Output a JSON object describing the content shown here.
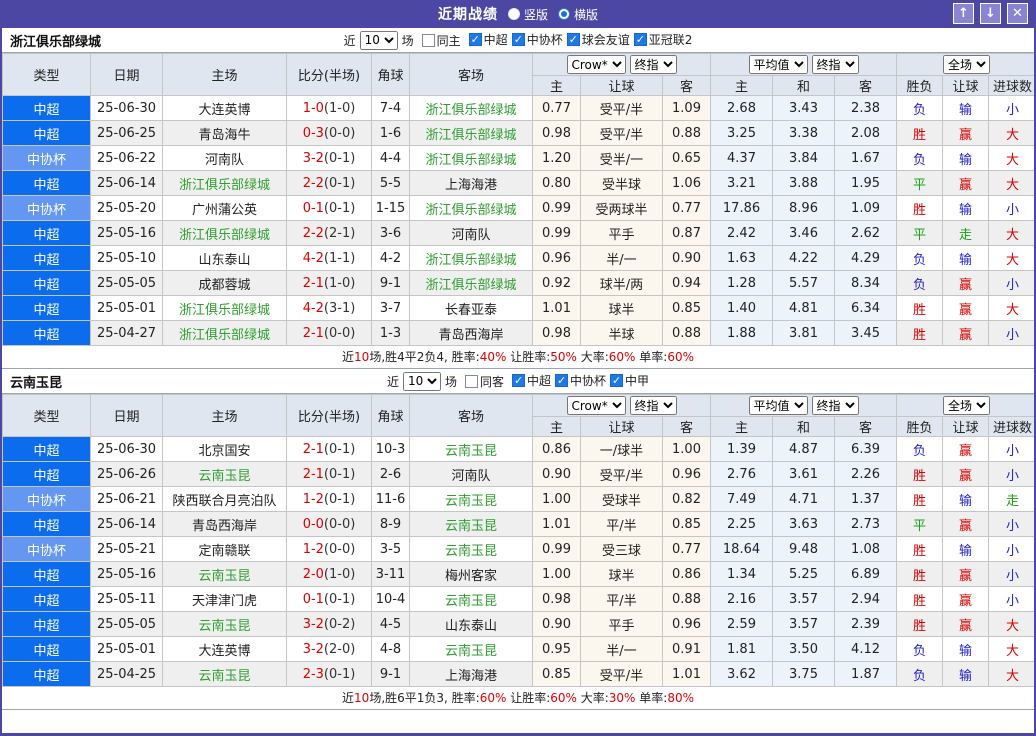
{
  "window": {
    "title": "近期战绩",
    "view_options": [
      {
        "label": "竖版",
        "checked": false
      },
      {
        "label": "横版",
        "checked": true
      }
    ],
    "controls": {
      "up_icon": "↑",
      "down_icon": "↓",
      "close_icon": "✕"
    }
  },
  "colors": {
    "accent_purple": "#4b47a3",
    "league_super_blue": "#0c6cee",
    "league_cup_blue": "#6397f2",
    "focus_team_green": "#2f9e2f",
    "win_red": "#dd0000",
    "lose_blue": "#2222cc",
    "draw_green": "#1ba11b",
    "handicap_bg": "#fcf7ee",
    "average_bg": "#ecf3fa",
    "header_bg": "#dfe6ef"
  },
  "table_header": {
    "left_columns": [
      "类型",
      "日期",
      "主场",
      "比分(半场)",
      "角球",
      "客场"
    ],
    "dropdown_groups": [
      [
        "Crow*",
        "终指"
      ],
      [
        "平均值",
        "终指"
      ],
      [
        "全场"
      ]
    ],
    "sub_columns": [
      "主",
      "让球",
      "客",
      "主",
      "和",
      "客",
      "胜负",
      "让球",
      "进球数"
    ]
  },
  "sections": [
    {
      "team": "浙江俱乐部绿城",
      "filter": {
        "prefix": "近",
        "count": "10",
        "suffix": "场",
        "same_label": "同主",
        "same_checked": false,
        "leagues": [
          {
            "label": "中超",
            "checked": true
          },
          {
            "label": "中协杯",
            "checked": true
          },
          {
            "label": "球会友谊",
            "checked": true
          },
          {
            "label": "亚冠联2",
            "checked": true
          }
        ]
      },
      "rows": [
        {
          "league": "中超",
          "league_cls": "sup",
          "date": "25-06-30",
          "home": "大连英博",
          "home_focus": false,
          "score": "1-0",
          "half": "(1-0)",
          "corners": "7-4",
          "away": "浙江俱乐部绿城",
          "away_focus": true,
          "handicap": [
            "0.77",
            "受平/半",
            "1.09"
          ],
          "average": [
            "2.68",
            "3.43",
            "2.38"
          ],
          "results": [
            [
              "负",
              "blue"
            ],
            [
              "输",
              "blue"
            ],
            [
              "小",
              "blue"
            ]
          ]
        },
        {
          "league": "中超",
          "league_cls": "sup",
          "date": "25-06-25",
          "home": "青岛海牛",
          "home_focus": false,
          "score": "0-3",
          "half": "(0-0)",
          "corners": "1-6",
          "away": "浙江俱乐部绿城",
          "away_focus": true,
          "handicap": [
            "0.98",
            "受平/半",
            "0.88"
          ],
          "average": [
            "3.25",
            "3.38",
            "2.08"
          ],
          "results": [
            [
              "胜",
              "red"
            ],
            [
              "赢",
              "red"
            ],
            [
              "大",
              "red"
            ]
          ]
        },
        {
          "league": "中协杯",
          "league_cls": "cup",
          "date": "25-06-22",
          "home": "河南队",
          "home_focus": false,
          "score": "3-2",
          "half": "(0-1)",
          "corners": "4-4",
          "away": "浙江俱乐部绿城",
          "away_focus": true,
          "handicap": [
            "1.20",
            "受半/一",
            "0.65"
          ],
          "average": [
            "4.37",
            "3.84",
            "1.67"
          ],
          "results": [
            [
              "负",
              "blue"
            ],
            [
              "输",
              "blue"
            ],
            [
              "大",
              "red"
            ]
          ]
        },
        {
          "league": "中超",
          "league_cls": "sup",
          "date": "25-06-14",
          "home": "浙江俱乐部绿城",
          "home_focus": true,
          "score": "2-2",
          "half": "(0-1)",
          "corners": "5-5",
          "away": "上海海港",
          "away_focus": false,
          "handicap": [
            "0.80",
            "受半球",
            "1.06"
          ],
          "average": [
            "3.21",
            "3.88",
            "1.95"
          ],
          "results": [
            [
              "平",
              "green"
            ],
            [
              "赢",
              "red"
            ],
            [
              "大",
              "red"
            ]
          ]
        },
        {
          "league": "中协杯",
          "league_cls": "cup",
          "date": "25-05-20",
          "home": "广州蒲公英",
          "home_focus": false,
          "score": "0-1",
          "half": "(0-1)",
          "corners": "1-15",
          "away": "浙江俱乐部绿城",
          "away_focus": true,
          "handicap": [
            "0.99",
            "受两球半",
            "0.77"
          ],
          "average": [
            "17.86",
            "8.96",
            "1.09"
          ],
          "results": [
            [
              "胜",
              "red"
            ],
            [
              "输",
              "blue"
            ],
            [
              "小",
              "blue"
            ]
          ]
        },
        {
          "league": "中超",
          "league_cls": "sup",
          "date": "25-05-16",
          "home": "浙江俱乐部绿城",
          "home_focus": true,
          "score": "2-2",
          "half": "(2-1)",
          "corners": "3-6",
          "away": "河南队",
          "away_focus": false,
          "handicap": [
            "0.99",
            "平手",
            "0.87"
          ],
          "average": [
            "2.42",
            "3.46",
            "2.62"
          ],
          "results": [
            [
              "平",
              "green"
            ],
            [
              "走",
              "green"
            ],
            [
              "大",
              "red"
            ]
          ]
        },
        {
          "league": "中超",
          "league_cls": "sup",
          "date": "25-05-10",
          "home": "山东泰山",
          "home_focus": false,
          "score": "4-2",
          "half": "(1-1)",
          "corners": "4-2",
          "away": "浙江俱乐部绿城",
          "away_focus": true,
          "handicap": [
            "0.96",
            "半/一",
            "0.90"
          ],
          "average": [
            "1.63",
            "4.22",
            "4.29"
          ],
          "results": [
            [
              "负",
              "blue"
            ],
            [
              "输",
              "blue"
            ],
            [
              "大",
              "red"
            ]
          ]
        },
        {
          "league": "中超",
          "league_cls": "sup",
          "date": "25-05-05",
          "home": "成都蓉城",
          "home_focus": false,
          "score": "2-1",
          "half": "(1-0)",
          "corners": "9-1",
          "away": "浙江俱乐部绿城",
          "away_focus": true,
          "handicap": [
            "0.92",
            "球半/两",
            "0.94"
          ],
          "average": [
            "1.28",
            "5.57",
            "8.34"
          ],
          "results": [
            [
              "负",
              "blue"
            ],
            [
              "赢",
              "red"
            ],
            [
              "小",
              "blue"
            ]
          ]
        },
        {
          "league": "中超",
          "league_cls": "sup",
          "date": "25-05-01",
          "home": "浙江俱乐部绿城",
          "home_focus": true,
          "score": "4-2",
          "half": "(3-1)",
          "corners": "3-7",
          "away": "长春亚泰",
          "away_focus": false,
          "handicap": [
            "1.01",
            "球半",
            "0.85"
          ],
          "average": [
            "1.40",
            "4.81",
            "6.34"
          ],
          "results": [
            [
              "胜",
              "red"
            ],
            [
              "赢",
              "red"
            ],
            [
              "大",
              "red"
            ]
          ]
        },
        {
          "league": "中超",
          "league_cls": "sup",
          "date": "25-04-27",
          "home": "浙江俱乐部绿城",
          "home_focus": true,
          "score": "2-1",
          "half": "(0-0)",
          "corners": "1-3",
          "away": "青岛西海岸",
          "away_focus": false,
          "handicap": [
            "0.98",
            "半球",
            "0.88"
          ],
          "average": [
            "1.88",
            "3.81",
            "3.45"
          ],
          "results": [
            [
              "胜",
              "red"
            ],
            [
              "赢",
              "red"
            ],
            [
              "小",
              "blue"
            ]
          ]
        }
      ],
      "summary": [
        {
          "text": "近",
          "red": false
        },
        {
          "text": "10",
          "red": true
        },
        {
          "text": "场,胜4平2负4, 胜率:",
          "red": false
        },
        {
          "text": "40%",
          "red": true
        },
        {
          "text": " 让胜率:",
          "red": false
        },
        {
          "text": "50%",
          "red": true
        },
        {
          "text": " 大率:",
          "red": false
        },
        {
          "text": "60%",
          "red": true
        },
        {
          "text": " 单率:",
          "red": false
        },
        {
          "text": "60%",
          "red": true
        }
      ]
    },
    {
      "team": "云南玉昆",
      "filter": {
        "prefix": "近",
        "count": "10",
        "suffix": "场",
        "same_label": "同客",
        "same_checked": false,
        "leagues": [
          {
            "label": "中超",
            "checked": true
          },
          {
            "label": "中协杯",
            "checked": true
          },
          {
            "label": "中甲",
            "checked": true
          }
        ]
      },
      "rows": [
        {
          "league": "中超",
          "league_cls": "sup",
          "date": "25-06-30",
          "home": "北京国安",
          "home_focus": false,
          "score": "2-1",
          "half": "(0-1)",
          "corners": "10-3",
          "away": "云南玉昆",
          "away_focus": true,
          "handicap": [
            "0.86",
            "一/球半",
            "1.00"
          ],
          "average": [
            "1.39",
            "4.87",
            "6.39"
          ],
          "results": [
            [
              "负",
              "blue"
            ],
            [
              "赢",
              "red"
            ],
            [
              "小",
              "blue"
            ]
          ]
        },
        {
          "league": "中超",
          "league_cls": "sup",
          "date": "25-06-26",
          "home": "云南玉昆",
          "home_focus": true,
          "score": "2-1",
          "half": "(0-1)",
          "corners": "2-6",
          "away": "河南队",
          "away_focus": false,
          "handicap": [
            "0.90",
            "受平/半",
            "0.96"
          ],
          "average": [
            "2.76",
            "3.61",
            "2.26"
          ],
          "results": [
            [
              "胜",
              "red"
            ],
            [
              "赢",
              "red"
            ],
            [
              "小",
              "blue"
            ]
          ]
        },
        {
          "league": "中协杯",
          "league_cls": "cup",
          "date": "25-06-21",
          "home": "陕西联合月亮泊队",
          "home_focus": false,
          "score": "1-2",
          "half": "(0-1)",
          "corners": "11-6",
          "away": "云南玉昆",
          "away_focus": true,
          "handicap": [
            "1.00",
            "受球半",
            "0.82"
          ],
          "average": [
            "7.49",
            "4.71",
            "1.37"
          ],
          "results": [
            [
              "胜",
              "red"
            ],
            [
              "输",
              "blue"
            ],
            [
              "走",
              "green"
            ]
          ]
        },
        {
          "league": "中超",
          "league_cls": "sup",
          "date": "25-06-14",
          "home": "青岛西海岸",
          "home_focus": false,
          "score": "0-0",
          "half": "(0-0)",
          "corners": "8-9",
          "away": "云南玉昆",
          "away_focus": true,
          "handicap": [
            "1.01",
            "平/半",
            "0.85"
          ],
          "average": [
            "2.25",
            "3.63",
            "2.73"
          ],
          "results": [
            [
              "平",
              "green"
            ],
            [
              "赢",
              "red"
            ],
            [
              "小",
              "blue"
            ]
          ]
        },
        {
          "league": "中协杯",
          "league_cls": "cup",
          "date": "25-05-21",
          "home": "定南赣联",
          "home_focus": false,
          "score": "1-2",
          "half": "(0-0)",
          "corners": "3-5",
          "away": "云南玉昆",
          "away_focus": true,
          "handicap": [
            "0.99",
            "受三球",
            "0.77"
          ],
          "average": [
            "18.64",
            "9.48",
            "1.08"
          ],
          "results": [
            [
              "胜",
              "red"
            ],
            [
              "输",
              "blue"
            ],
            [
              "小",
              "blue"
            ]
          ]
        },
        {
          "league": "中超",
          "league_cls": "sup",
          "date": "25-05-16",
          "home": "云南玉昆",
          "home_focus": true,
          "score": "2-0",
          "half": "(1-0)",
          "corners": "3-11",
          "away": "梅州客家",
          "away_focus": false,
          "handicap": [
            "1.00",
            "球半",
            "0.86"
          ],
          "average": [
            "1.34",
            "5.25",
            "6.89"
          ],
          "results": [
            [
              "胜",
              "red"
            ],
            [
              "赢",
              "red"
            ],
            [
              "小",
              "blue"
            ]
          ]
        },
        {
          "league": "中超",
          "league_cls": "sup",
          "date": "25-05-11",
          "home": "天津津门虎",
          "home_focus": false,
          "score": "0-1",
          "half": "(0-1)",
          "corners": "10-4",
          "away": "云南玉昆",
          "away_focus": true,
          "handicap": [
            "0.98",
            "平/半",
            "0.88"
          ],
          "average": [
            "2.16",
            "3.57",
            "2.94"
          ],
          "results": [
            [
              "胜",
              "red"
            ],
            [
              "赢",
              "red"
            ],
            [
              "小",
              "blue"
            ]
          ]
        },
        {
          "league": "中超",
          "league_cls": "sup",
          "date": "25-05-05",
          "home": "云南玉昆",
          "home_focus": true,
          "score": "3-2",
          "half": "(0-2)",
          "corners": "4-5",
          "away": "山东泰山",
          "away_focus": false,
          "handicap": [
            "0.90",
            "平手",
            "0.96"
          ],
          "average": [
            "2.59",
            "3.57",
            "2.39"
          ],
          "results": [
            [
              "胜",
              "red"
            ],
            [
              "赢",
              "red"
            ],
            [
              "大",
              "red"
            ]
          ]
        },
        {
          "league": "中超",
          "league_cls": "sup",
          "date": "25-05-01",
          "home": "大连英博",
          "home_focus": false,
          "score": "3-2",
          "half": "(2-0)",
          "corners": "4-8",
          "away": "云南玉昆",
          "away_focus": true,
          "handicap": [
            "0.95",
            "半/一",
            "0.91"
          ],
          "average": [
            "1.81",
            "3.50",
            "4.12"
          ],
          "results": [
            [
              "负",
              "blue"
            ],
            [
              "输",
              "blue"
            ],
            [
              "大",
              "red"
            ]
          ]
        },
        {
          "league": "中超",
          "league_cls": "sup",
          "date": "25-04-25",
          "home": "云南玉昆",
          "home_focus": true,
          "score": "2-3",
          "half": "(0-1)",
          "corners": "9-1",
          "away": "上海海港",
          "away_focus": false,
          "handicap": [
            "0.85",
            "受平/半",
            "1.01"
          ],
          "average": [
            "3.62",
            "3.75",
            "1.87"
          ],
          "results": [
            [
              "负",
              "blue"
            ],
            [
              "输",
              "blue"
            ],
            [
              "大",
              "red"
            ]
          ]
        }
      ],
      "summary": [
        {
          "text": "近",
          "red": false
        },
        {
          "text": "10",
          "red": true
        },
        {
          "text": "场,胜6平1负3, 胜率:",
          "red": false
        },
        {
          "text": "60%",
          "red": true
        },
        {
          "text": " 让胜率:",
          "red": false
        },
        {
          "text": "60%",
          "red": true
        },
        {
          "text": " 大率:",
          "red": false
        },
        {
          "text": "30%",
          "red": true
        },
        {
          "text": " 单率:",
          "red": false
        },
        {
          "text": "80%",
          "red": true
        }
      ]
    }
  ]
}
